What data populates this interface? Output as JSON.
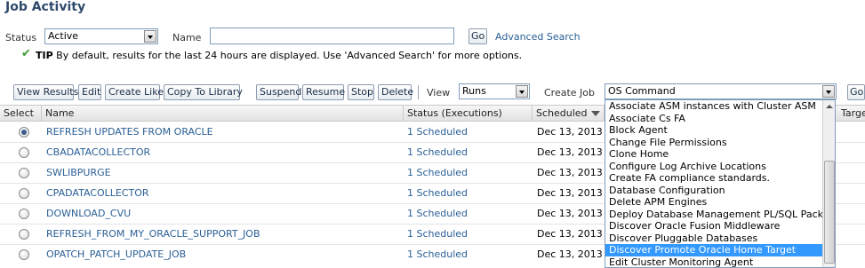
{
  "page": {
    "title": "Job Activity"
  },
  "filter": {
    "status_label": "Status",
    "status_value": "Active",
    "name_label": "Name",
    "name_value": "",
    "go_label": "Go",
    "advanced_search": "Advanced Search"
  },
  "tip": {
    "bold": "TIP",
    "text": "By default, results for the last 24 hours are displayed. Use 'Advanced Search' for more options."
  },
  "toolbar": {
    "view_results": "View Results",
    "edit": "Edit",
    "create_like": "Create Like",
    "copy_to_library": "Copy To Library",
    "suspend": "Suspend",
    "resume": "Resume",
    "stop": "Stop",
    "delete": "Delete",
    "view_label": "View",
    "view_value": "Runs",
    "create_job_label": "Create Job",
    "create_job_value": "OS Command",
    "go_label": "Go"
  },
  "table": {
    "headers": {
      "select": "Select",
      "name": "Name",
      "status": "Status (Executions)",
      "scheduled": "Scheduled",
      "target": "Targe"
    },
    "rows": [
      {
        "name": "REFRESH UPDATES FROM ORACLE",
        "status": "1 Scheduled",
        "scheduled": "Dec 13, 2013 1",
        "selected": true
      },
      {
        "name": "CBADATACOLLECTOR",
        "status": "1 Scheduled",
        "scheduled": "Dec 13, 2013 3",
        "selected": false
      },
      {
        "name": "SWLIBPURGE",
        "status": "1 Scheduled",
        "scheduled": "Dec 13, 2013 2",
        "selected": false
      },
      {
        "name": "CPADATACOLLECTOR",
        "status": "1 Scheduled",
        "scheduled": "Dec 13, 2013 1",
        "selected": false
      },
      {
        "name": "DOWNLOAD_CVU",
        "status": "1 Scheduled",
        "scheduled": "Dec 13, 2013 1",
        "selected": false
      },
      {
        "name": "REFRESH_FROM_MY_ORACLE_SUPPORT_JOB",
        "status": "1 Scheduled",
        "scheduled": "Dec 13, 2013 1",
        "selected": false
      },
      {
        "name": "OPATCH_PATCH_UPDATE_JOB",
        "status": "1 Scheduled",
        "scheduled": "Dec 13, 2013 1",
        "selected": false
      }
    ]
  },
  "dropdown": {
    "items": [
      "Associate ASM instances with Cluster ASM",
      "Associate Cs FA",
      "Block Agent",
      "Change File Permissions",
      "Clone Home",
      "Configure Log Archive Locations",
      "Create FA compliance standards.",
      "Database Configuration",
      "Delete APM Engines",
      "Deploy Database Management PL/SQL Packages",
      "Discover Oracle Fusion Middleware",
      "Discover Pluggable Databases",
      "Discover Promote Oracle Home Target",
      "Edit Cluster Monitoring Agent"
    ],
    "selected_index": 12,
    "highlight_color": "#3399ff"
  },
  "colors": {
    "title": "#2f4a6d",
    "link": "#2a5f95",
    "tip_check": "#3c9a2f"
  },
  "icons": {
    "tip": "checkmark-icon",
    "sort": "sort-descending-icon"
  }
}
